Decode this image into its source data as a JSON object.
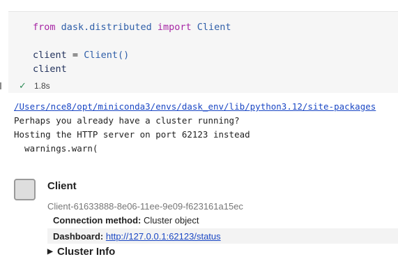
{
  "code_cell": {
    "line1": {
      "from": "from",
      "module": "dask.distributed",
      "import": "import",
      "name": "Client"
    },
    "line2": {
      "var": "client",
      "op": "=",
      "call": "Client()"
    },
    "line3": "client",
    "status_time": "1.8s"
  },
  "output": {
    "path": "/Users/nce8/opt/miniconda3/envs/dask_env/lib/python3.12/site-packages",
    "line2": "Perhaps you already have a cluster running?",
    "line3": "Hosting the HTTP server on port 62123 instead",
    "line4": "  warnings.warn("
  },
  "client_widget": {
    "title": "Client",
    "id": "Client-61633888-8e06-11ee-9e09-f623161a15ec",
    "connection_label": "Connection method:",
    "connection_value": "Cluster object",
    "dashboard_label": "Dashboard:",
    "dashboard_link": "http://127.0.0.1:62123/status",
    "cluster_info": "Cluster Info"
  }
}
